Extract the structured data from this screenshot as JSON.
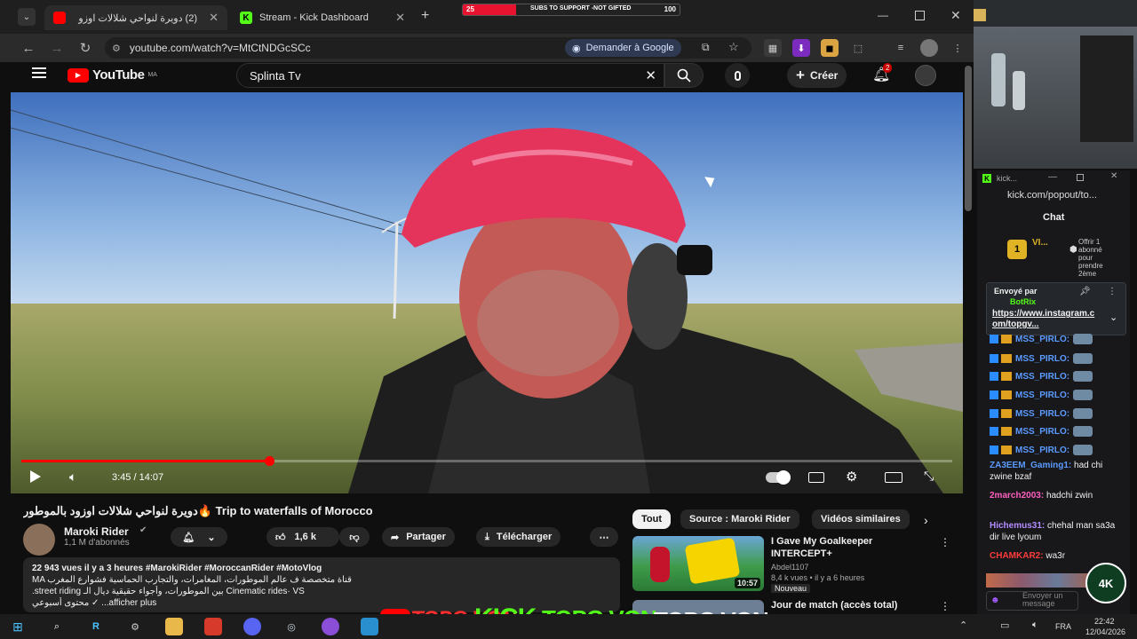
{
  "browser": {
    "tabs": [
      {
        "label": "(2) دويرة لنواحي شلالات اوزو",
        "active": true
      },
      {
        "label": "Stream - Kick Dashboard",
        "active": false
      }
    ],
    "url": "youtube.com/watch?v=MtCtNDGcSCc",
    "ask_google": "Demander à Google"
  },
  "overlay_banner": {
    "left_num": "25",
    "text": "SUBS TO SUPPORT -NOT GIFTED",
    "right_num": "100"
  },
  "youtube": {
    "logo": "YouTube",
    "region": "MA",
    "search_value": "Splinta Tv",
    "create_label": "Créer",
    "notif_count": "2",
    "player": {
      "time": "3:45 / 14:07",
      "progress_fraction": 0.266
    },
    "video_title": "دويرة لنواحي شلالات اوزود بالموطور🔥 Trip to waterfalls of Morocco",
    "channel_name": "Maroki Rider",
    "subscribers": "1,1 M d'abonnés",
    "likes": "1,6 k",
    "share_label": "Partager",
    "download_label": "Télécharger",
    "description": {
      "meta": "22 943 vues  il y a 3 heures  #MarokiRider #MoroccanRider #MotoVlog",
      "line1": "MA قناة متخصصة ف عالم الموطورات، المغامرات، والتجارب الحماسية فشوارع المغرب",
      "line2": ".street riding بين الموطورات، وأجواء حقيقية ديال الـ Cinematic rides· VS",
      "line3": "محتوى أسبوعي ✓ ...afficher plus"
    },
    "chips": [
      "Tout",
      "Source : Maroki Rider",
      "Vidéos similaires"
    ],
    "recommendations": [
      {
        "title": "I Gave My Goalkeeper INTERCEPT+",
        "channel": "Abdel1107",
        "meta": "8,4 k vues  •  il y a 6 heures",
        "badge": "Nouveau",
        "duration": "10:57"
      },
      {
        "title": "Jour de match (accès total)",
        "channel": "",
        "meta": "",
        "badge": "",
        "duration": ""
      }
    ]
  },
  "kick": {
    "window_title": "kick...",
    "url": "kick.com/popout/to...",
    "chat_title": "Chat",
    "top_user": "VI...",
    "gift_text": "Offrir 1 abonné pour prendre 2ème",
    "pinned": {
      "sent_by": "Envoyé par",
      "user": "BotRix",
      "link": "https://www.instagram.com/topgv..."
    },
    "repeat_user": "MSS_PIRLO:",
    "messages": [
      {
        "user": "ZA3EEM_Gaming1:",
        "text": "had chi zwine bzaf",
        "color": "#5b9bff"
      },
      {
        "user": "2march2003:",
        "text": "hadchi zwin",
        "color": "#ff5fbf"
      },
      {
        "user": "Hichemus31:",
        "text": "chehal man sa3a dir live lyoum",
        "color": "#b38cff"
      },
      {
        "user": "CHAMKAR2:",
        "text": "wa3r",
        "color": "#ff3b3b"
      }
    ],
    "send_placeholder": "Envoyer un message"
  },
  "taskbar": {
    "time": "22:42",
    "date": "12/04/2026",
    "lang": "FRA"
  },
  "stream_overlay": {
    "text1": "TOPG VON",
    "text2": "TOPG VON",
    "kick_text": "KICK"
  },
  "colors": {
    "yt_red": "#ff0000",
    "kick_green": "#53fc18"
  }
}
